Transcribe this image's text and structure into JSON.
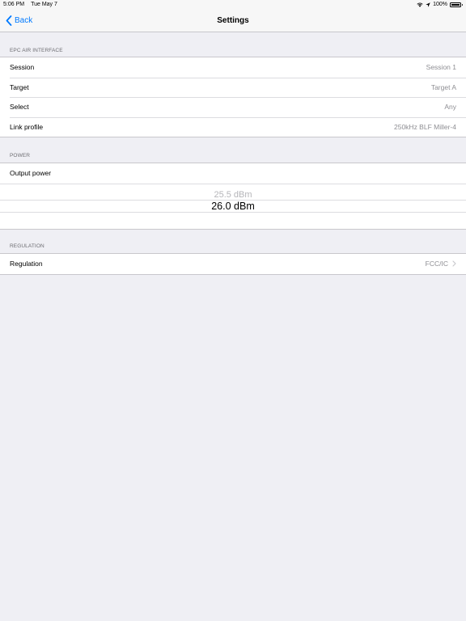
{
  "status_bar": {
    "time": "5:06 PM",
    "date": "Tue May 7",
    "battery": "100%"
  },
  "nav": {
    "back_label": "Back",
    "title": "Settings"
  },
  "sections": {
    "epc": {
      "header": "EPC AIR INTERFACE",
      "rows": [
        {
          "label": "Session",
          "value": "Session 1"
        },
        {
          "label": "Target",
          "value": "Target A"
        },
        {
          "label": "Select",
          "value": "Any"
        },
        {
          "label": "Link profile",
          "value": "250kHz BLF Miller-4"
        }
      ]
    },
    "power": {
      "header": "POWER",
      "label": "Output power",
      "picker_prev": "25.5 dBm",
      "picker_selected": "26.0 dBm"
    },
    "regulation": {
      "header": "REGULATION",
      "label": "Regulation",
      "value": "FCC/IC"
    }
  },
  "colors": {
    "accent": "#007aff",
    "background": "#efeff4",
    "secondary_text": "#8e8e93"
  }
}
